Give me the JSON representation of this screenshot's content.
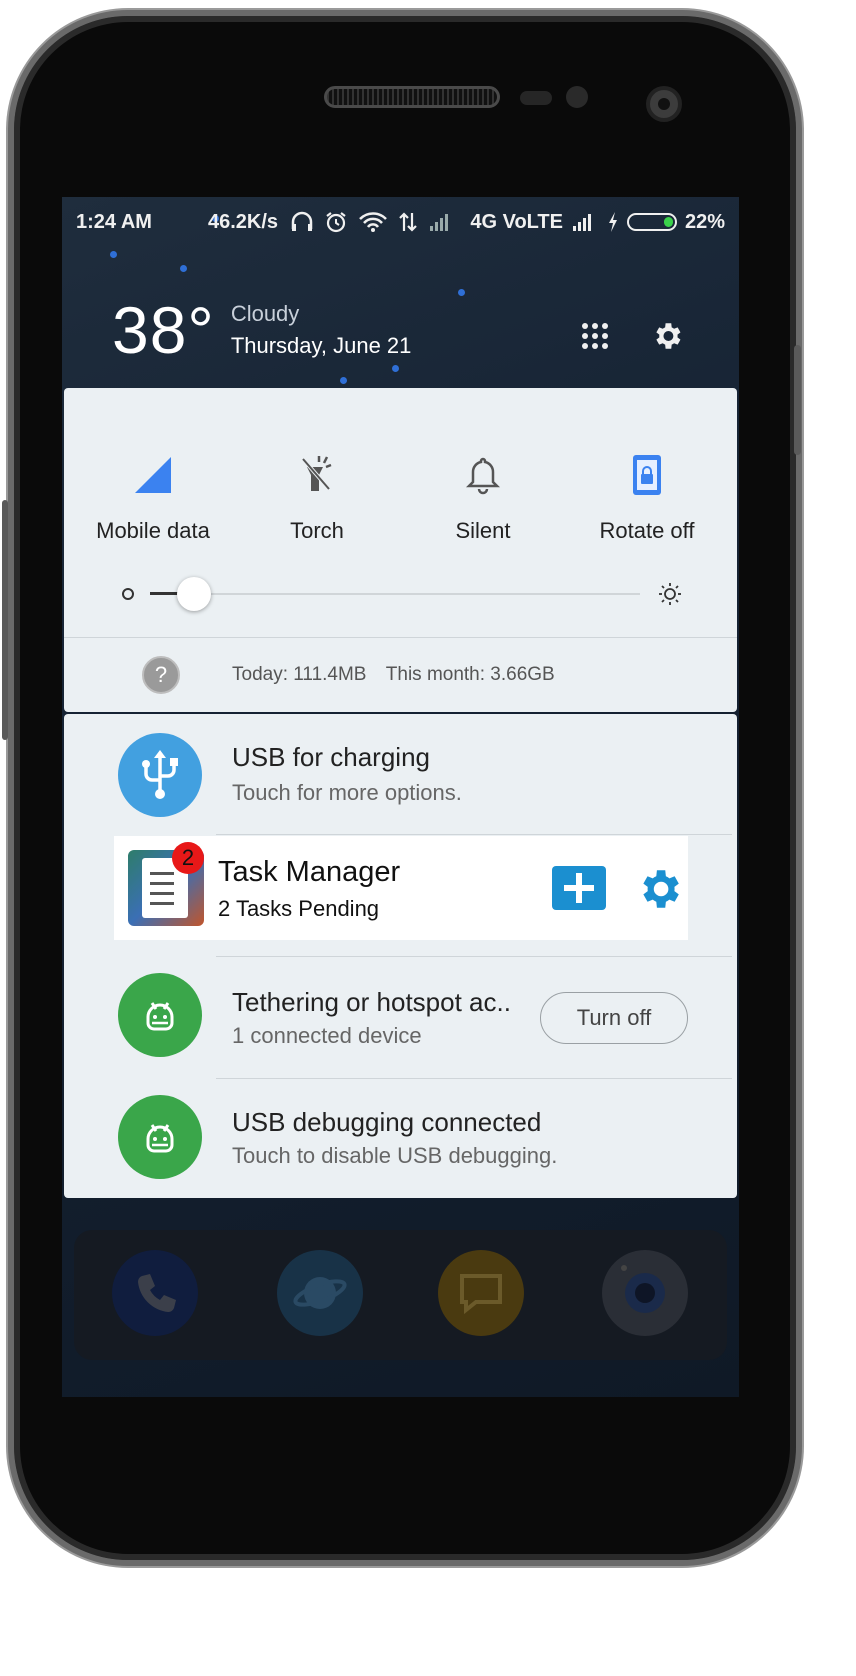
{
  "status_bar": {
    "time": "1:24 AM",
    "net_speed": "46.2K/s",
    "network": "4G VoLTE",
    "battery": "22%",
    "battery_level": 0.22,
    "icons": [
      "headphones-icon",
      "alarm-icon",
      "wifi-icon",
      "data-arrows-icon",
      "signal-icon",
      "signal-icon",
      "charging-icon",
      "battery-icon"
    ]
  },
  "weather": {
    "temperature": "38°",
    "condition": "Cloudy",
    "date": "Thursday, June 21"
  },
  "quick_settings": {
    "tiles": [
      {
        "label": "Mobile data",
        "icon": "mobile-data-icon"
      },
      {
        "label": "Torch",
        "icon": "torch-icon"
      },
      {
        "label": "Silent",
        "icon": "bell-icon"
      },
      {
        "label": "Rotate off",
        "icon": "rotate-lock-icon"
      }
    ],
    "brightness_level": 0.09,
    "data_usage": {
      "help": "?",
      "today": "Today: 111.4MB",
      "month": "This month: 3.66GB"
    }
  },
  "notifications": {
    "usb_charging": {
      "title": "USB for charging",
      "subtitle": "Touch for more options."
    },
    "task_manager": {
      "title": "Task Manager",
      "subtitle": "2 Tasks Pending",
      "badge": "2"
    },
    "tethering": {
      "title": "Tethering or hotspot ac..",
      "subtitle": "1 connected device",
      "button": "Turn off"
    },
    "usb_debugging": {
      "title": "USB debugging connected",
      "subtitle": "Touch to disable USB debugging."
    }
  },
  "colors": {
    "accent_blue": "#1b8fd0",
    "android_green": "#3aa64a",
    "usb_blue": "#42a0e0",
    "panel_bg": "#ebf0f3",
    "badge_red": "#e81818"
  }
}
